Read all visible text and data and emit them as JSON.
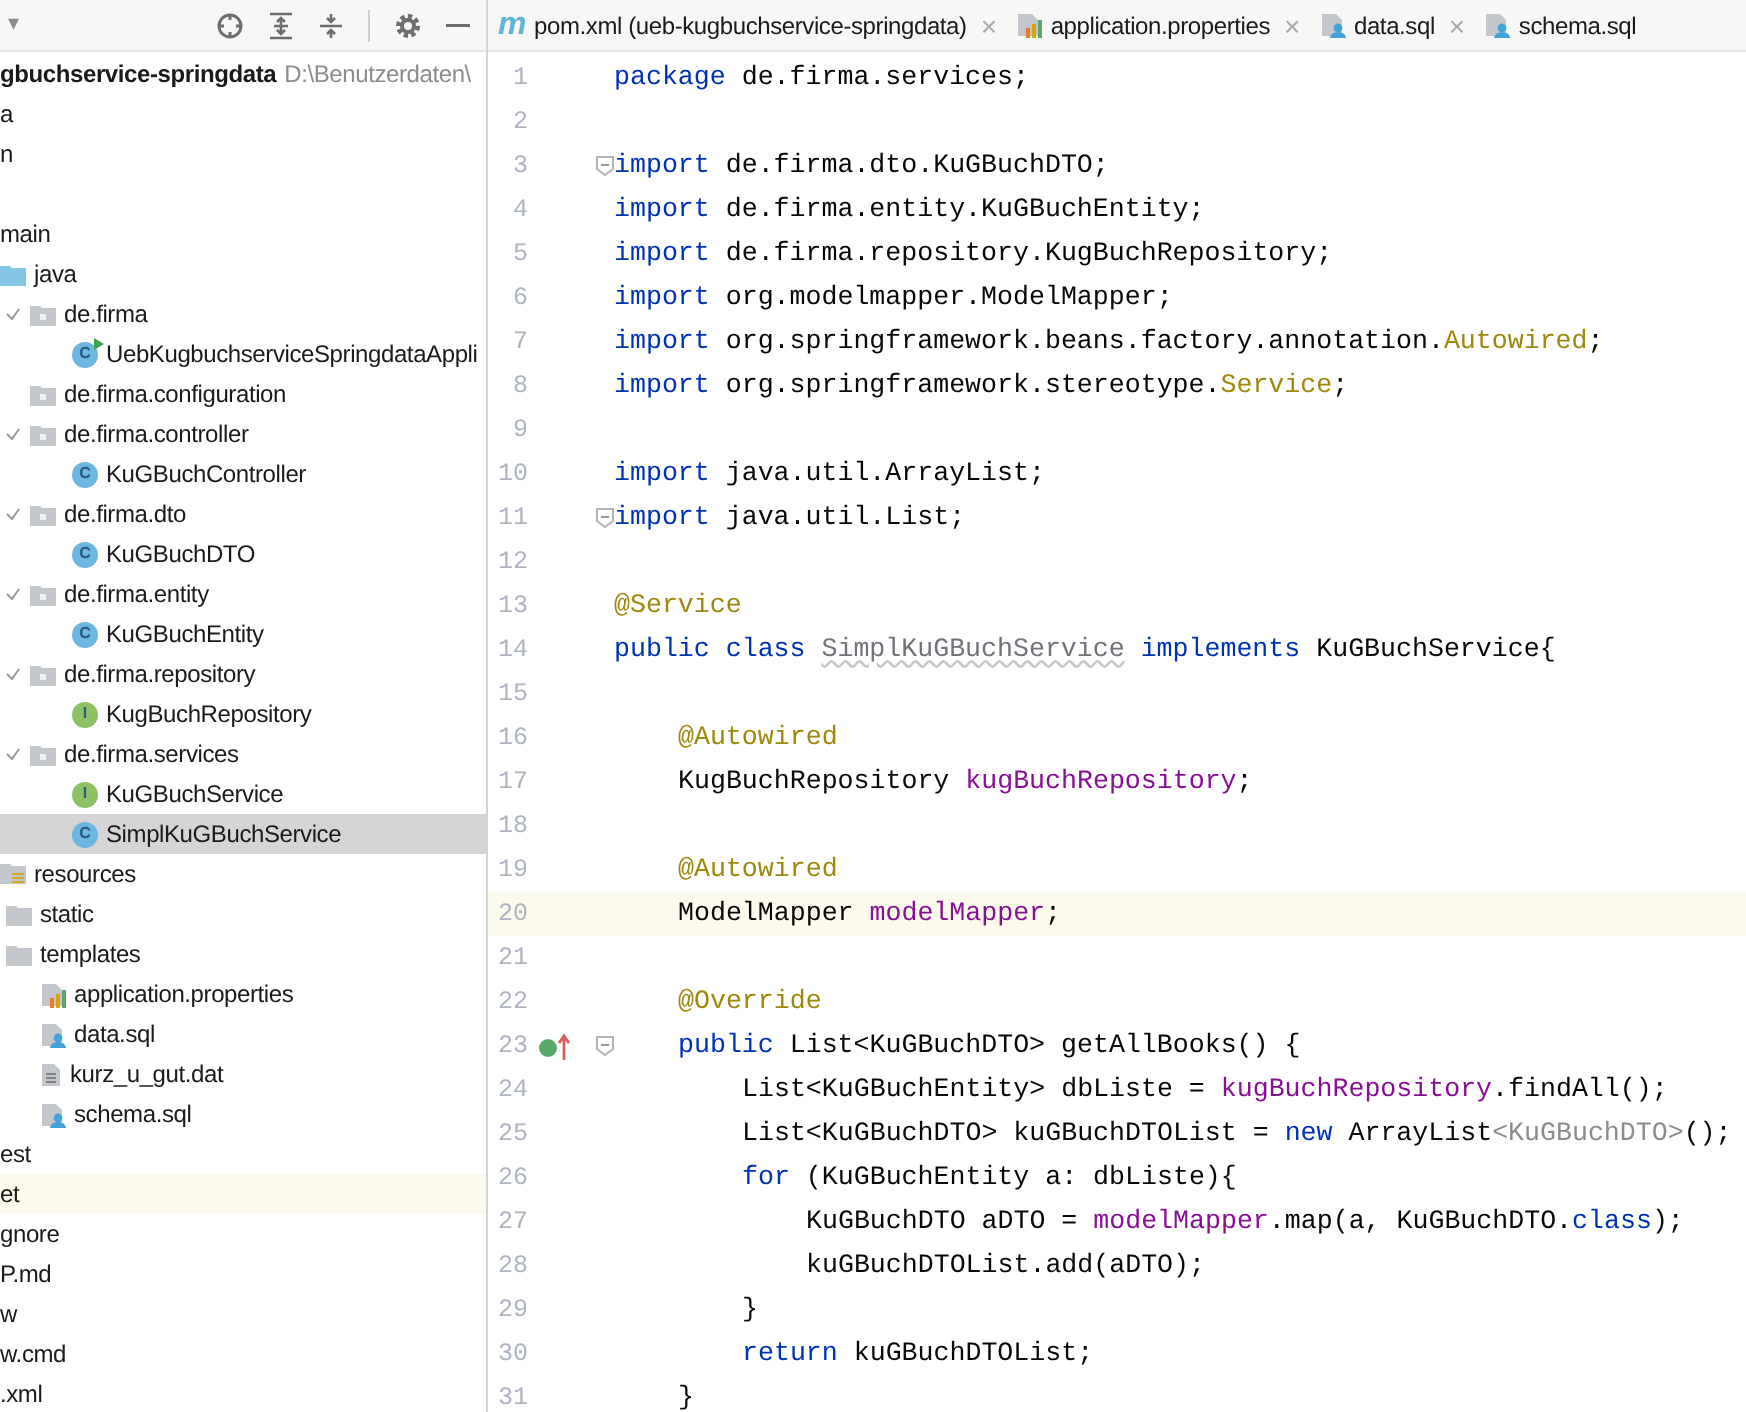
{
  "project_panel": {
    "header": {
      "caret": "▾"
    },
    "tree": [
      {
        "kind": "module",
        "label": "gbuchservice-springdata",
        "path": "D:\\Benutzerdaten\\",
        "children": [
          {
            "label": "a"
          },
          {
            "label": "n",
            "children": [
              {
                "children": [
                  {
                    "label": "main",
                    "children": [
                      {
                        "kind": "source",
                        "label": "java",
                        "children": [
                          {
                            "kind": "package",
                            "label": "de.firma",
                            "expanded": true,
                            "children": [
                              {
                                "kind": "app",
                                "badge": "C",
                                "label": "UebKugbuchserviceSpringdataAppli",
                                "selected": false
                              }
                            ]
                          },
                          {
                            "kind": "package",
                            "label": "de.firma.configuration",
                            "expanded": false
                          },
                          {
                            "kind": "package",
                            "label": "de.firma.controller",
                            "expanded": true,
                            "children": [
                              {
                                "kind": "class",
                                "badge": "C",
                                "label": "KuGBuchController",
                                "selected": false
                              }
                            ]
                          },
                          {
                            "kind": "package",
                            "label": "de.firma.dto",
                            "expanded": true,
                            "children": [
                              {
                                "kind": "class",
                                "badge": "C",
                                "label": "KuGBuchDTO",
                                "selected": false
                              }
                            ]
                          },
                          {
                            "kind": "package",
                            "label": "de.firma.entity",
                            "expanded": true,
                            "children": [
                              {
                                "kind": "class",
                                "badge": "C",
                                "label": "KuGBuchEntity",
                                "selected": false
                              }
                            ]
                          },
                          {
                            "kind": "package",
                            "label": "de.firma.repository",
                            "expanded": true,
                            "children": [
                              {
                                "kind": "interface",
                                "badge": "I",
                                "label": "KugBuchRepository",
                                "selected": false
                              }
                            ]
                          },
                          {
                            "kind": "package",
                            "label": "de.firma.services",
                            "expanded": true,
                            "children": [
                              {
                                "kind": "interface",
                                "badge": "I",
                                "label": "KuGBuchService",
                                "selected": false
                              },
                              {
                                "kind": "class",
                                "badge": "C",
                                "label": "SimplKuGBuchService",
                                "selected": true
                              }
                            ]
                          }
                        ]
                      },
                      {
                        "kind": "resources",
                        "label": "resources",
                        "children": [
                          {
                            "kind": "folder",
                            "label": "static"
                          },
                          {
                            "kind": "folder",
                            "label": "templates"
                          },
                          {
                            "kind": "properties",
                            "label": "application.properties"
                          },
                          {
                            "kind": "sql",
                            "label": "data.sql"
                          },
                          {
                            "kind": "text",
                            "label": "kurz_u_gut.dat"
                          },
                          {
                            "kind": "sql",
                            "label": "schema.sql"
                          }
                        ]
                      }
                    ]
                  },
                  {
                    "label": "est"
                  }
                ]
              }
            ]
          },
          {
            "label": "et",
            "highlighted": true
          },
          {
            "label": "gnore"
          },
          {
            "label": "P.md"
          },
          {
            "label": "w"
          },
          {
            "label": "w.cmd"
          },
          {
            "label": ".xml"
          }
        ]
      }
    ]
  },
  "tabs": [
    {
      "kind": "maven",
      "icon_text": "m",
      "label": "pom.xml (ueb-kugbuchservice-springdata)",
      "close": "×"
    },
    {
      "kind": "properties",
      "label": "application.properties",
      "close": "×"
    },
    {
      "kind": "sql",
      "label": "data.sql",
      "close": "×"
    },
    {
      "kind": "sql",
      "label": "schema.sql"
    }
  ],
  "editor": {
    "lines": [
      {
        "number": "1",
        "tokens": [
          {
            "kind": "keyword",
            "text": "package"
          },
          {
            "kind": "plain",
            "text": " de.firma.services;"
          }
        ]
      },
      {
        "number": "2"
      },
      {
        "number": "3",
        "fold": true,
        "tokens": [
          {
            "kind": "keyword",
            "text": "import"
          },
          {
            "kind": "plain",
            "text": " de.firma.dto.KuGBuchDTO;"
          }
        ]
      },
      {
        "number": "4",
        "tokens": [
          {
            "kind": "keyword",
            "text": "import"
          },
          {
            "kind": "plain",
            "text": " de.firma.entity.KuGBuchEntity;"
          }
        ]
      },
      {
        "number": "5",
        "tokens": [
          {
            "kind": "keyword",
            "text": "import"
          },
          {
            "kind": "plain",
            "text": " de.firma.repository.KugBuchRepository;"
          }
        ]
      },
      {
        "number": "6",
        "tokens": [
          {
            "kind": "keyword",
            "text": "import"
          },
          {
            "kind": "plain",
            "text": " org.modelmapper.ModelMapper;"
          }
        ]
      },
      {
        "number": "7",
        "tokens": [
          {
            "kind": "keyword",
            "text": "import"
          },
          {
            "kind": "plain",
            "text": " org.springframework.beans.factory.annotation."
          },
          {
            "kind": "annotation",
            "text": "Autowired"
          },
          {
            "kind": "plain",
            "text": ";"
          }
        ]
      },
      {
        "number": "8",
        "tokens": [
          {
            "kind": "keyword",
            "text": "import"
          },
          {
            "kind": "plain",
            "text": " org.springframework.stereotype."
          },
          {
            "kind": "annotation",
            "text": "Service"
          },
          {
            "kind": "plain",
            "text": ";"
          }
        ]
      },
      {
        "number": "9"
      },
      {
        "number": "10",
        "tokens": [
          {
            "kind": "keyword",
            "text": "import"
          },
          {
            "kind": "plain",
            "text": " java.util.ArrayList;"
          }
        ]
      },
      {
        "number": "11",
        "fold": true,
        "tokens": [
          {
            "kind": "keyword",
            "text": "import"
          },
          {
            "kind": "plain",
            "text": " java.util.List;"
          }
        ]
      },
      {
        "number": "12"
      },
      {
        "number": "13",
        "tokens": [
          {
            "kind": "annotation",
            "text": "@Service"
          }
        ]
      },
      {
        "number": "14",
        "tokens": [
          {
            "kind": "keyword",
            "text": "public class "
          },
          {
            "kind": "unused",
            "text": "SimplKuGBuchService"
          },
          {
            "kind": "keyword",
            "text": " implements "
          },
          {
            "kind": "plain",
            "text": "KuGBuchService{"
          }
        ]
      },
      {
        "number": "15"
      },
      {
        "number": "16",
        "kind": "member",
        "tokens": [
          {
            "kind": "annotation",
            "text": "@Autowired"
          }
        ]
      },
      {
        "number": "17",
        "kind": "member",
        "tokens": [
          {
            "kind": "plain",
            "text": "KugBuchRepository "
          },
          {
            "kind": "field",
            "text": "kugBuchRepository"
          },
          {
            "kind": "plain",
            "text": ";"
          }
        ]
      },
      {
        "number": "18"
      },
      {
        "number": "19",
        "kind": "member",
        "tokens": [
          {
            "kind": "annotation",
            "text": "@Autowired"
          }
        ]
      },
      {
        "number": "20",
        "current": true,
        "kind": "member",
        "tokens": [
          {
            "kind": "plain",
            "text": "ModelMapper "
          },
          {
            "kind": "field",
            "text": "modelMapper"
          },
          {
            "kind": "plain",
            "text": ";"
          }
        ]
      },
      {
        "number": "21"
      },
      {
        "number": "22",
        "kind": "member",
        "tokens": [
          {
            "kind": "annotation",
            "text": "@Override"
          }
        ]
      },
      {
        "number": "23",
        "fold": true,
        "implements": true,
        "kind": "member",
        "tokens": [
          {
            "kind": "keyword",
            "text": "public"
          },
          {
            "kind": "plain",
            "text": " List<KuGBuchDTO> getAllBooks() {"
          }
        ]
      },
      {
        "number": "24",
        "kind": "body",
        "tokens": [
          {
            "kind": "plain",
            "text": "List<KuGBuchEntity> dbListe = "
          },
          {
            "kind": "field",
            "text": "kugBuchRepository"
          },
          {
            "kind": "plain",
            "text": ".findAll();"
          }
        ]
      },
      {
        "number": "25",
        "kind": "body",
        "tokens": [
          {
            "kind": "plain",
            "text": "List<KuGBuchDTO> kuGBuchDTOList = "
          },
          {
            "kind": "keyword",
            "text": "new"
          },
          {
            "kind": "plain",
            "text": " ArrayList"
          },
          {
            "kind": "redundant",
            "text": "<KuGBuchDTO>"
          },
          {
            "kind": "plain",
            "text": "();"
          }
        ]
      },
      {
        "number": "26",
        "kind": "body",
        "tokens": [
          {
            "kind": "keyword",
            "text": "for"
          },
          {
            "kind": "plain",
            "text": " (KuGBuchEntity a: dbListe){"
          }
        ]
      },
      {
        "number": "27",
        "kind": "nested",
        "tokens": [
          {
            "kind": "plain",
            "text": "KuGBuchDTO aDTO = "
          },
          {
            "kind": "field",
            "text": "modelMapper"
          },
          {
            "kind": "plain",
            "text": ".map(a, KuGBuchDTO."
          },
          {
            "kind": "keyword",
            "text": "class"
          },
          {
            "kind": "plain",
            "text": ");"
          }
        ]
      },
      {
        "number": "28",
        "kind": "nested",
        "tokens": [
          {
            "kind": "plain",
            "text": "kuGBuchDTOList.add(aDTO);"
          }
        ]
      },
      {
        "number": "29",
        "kind": "body",
        "tokens": [
          {
            "kind": "plain",
            "text": "}"
          }
        ]
      },
      {
        "number": "30",
        "kind": "body",
        "tokens": [
          {
            "kind": "keyword",
            "text": "return"
          },
          {
            "kind": "plain",
            "text": " kuGBuchDTOList;"
          }
        ]
      },
      {
        "number": "31",
        "kind": "member",
        "tokens": [
          {
            "kind": "plain",
            "text": "}"
          }
        ]
      }
    ]
  }
}
